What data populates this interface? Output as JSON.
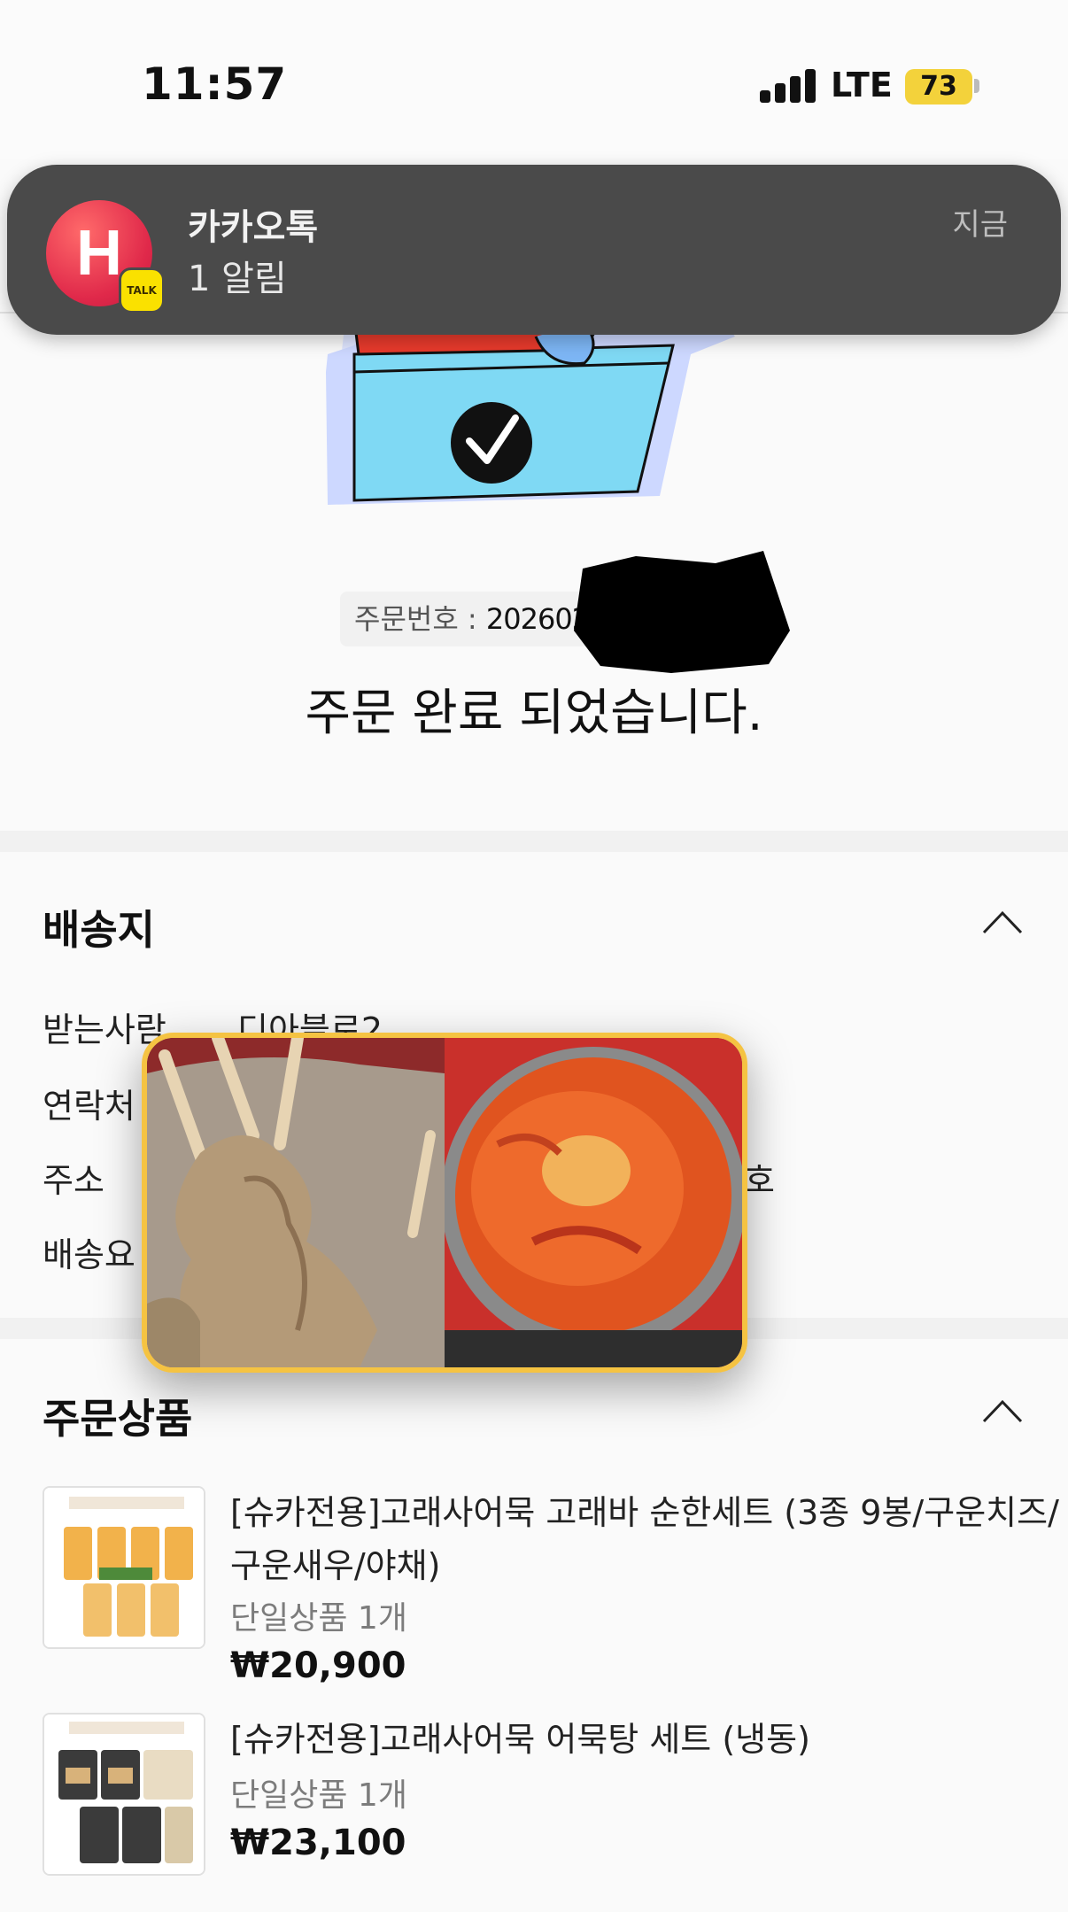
{
  "status_bar": {
    "time": "11:57",
    "network": "LTE",
    "battery": "73",
    "battery_color": "#f3d23b"
  },
  "notification": {
    "app_icon_letter": "H",
    "badge": "TALK",
    "app_name": "카카오톡",
    "message": "1 알림",
    "time": "지금"
  },
  "order": {
    "number_label": "주문번호 :",
    "number_value": "20260224",
    "complete_message": "주문 완료 되었습니다."
  },
  "shipping": {
    "title": "배송지",
    "rows": [
      {
        "label": "받는사람",
        "value": "디아블로2"
      },
      {
        "label": "연락처",
        "value": ""
      },
      {
        "label": "주소",
        "value": ""
      },
      {
        "label": "배송요",
        "value": ""
      }
    ],
    "address_tail": "호"
  },
  "order_items": {
    "title": "주문상품",
    "items": [
      {
        "name": "[슈카전용]고래사어묵 고래바 순한세트 (3종 9봉/구운치즈/구운새우/야채)",
        "option": "단일상품 1개",
        "price": "₩20,900"
      },
      {
        "name": "[슈카전용]고래사어묵 어묵탕 세트 (냉동)",
        "option": "단일상품 1개",
        "price": "₩23,100"
      }
    ]
  },
  "colors": {
    "notification_bg": "#4a4a4a",
    "kakao_yellow": "#fae100",
    "popup_border": "#f5c342"
  }
}
